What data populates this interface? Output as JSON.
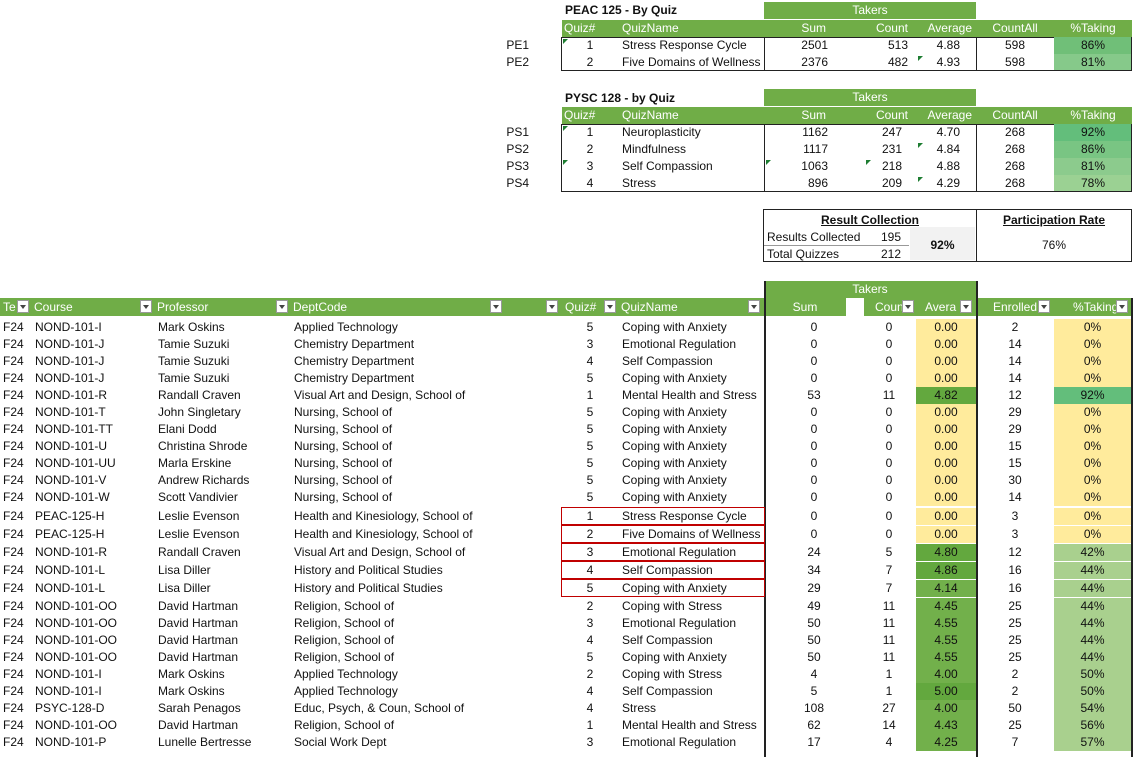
{
  "peac": {
    "title": "PEAC 125 - By Quiz",
    "takers_label": "Takers",
    "headers": [
      "Quiz#",
      "QuizName",
      "Sum",
      "Count",
      "Average",
      "CountAll",
      "%Taking"
    ],
    "rows": [
      {
        "id": "PE1",
        "quiz": "1",
        "name": "Stress Response Cycle",
        "sum": "2501",
        "count": "513",
        "avg": "4.88",
        "countall": "598",
        "pct": "86%"
      },
      {
        "id": "PE2",
        "quiz": "2",
        "name": "Five Domains of Wellness",
        "sum": "2376",
        "count": "482",
        "avg": "4.93",
        "countall": "598",
        "pct": "81%"
      }
    ]
  },
  "pysc": {
    "title": "PYSC 128 - by Quiz",
    "takers_label": "Takers",
    "headers": [
      "Quiz#",
      "QuizName",
      "Sum",
      "Count",
      "Average",
      "CountAll",
      "%Taking"
    ],
    "rows": [
      {
        "id": "PS1",
        "quiz": "1",
        "name": "Neuroplasticity",
        "sum": "1162",
        "count": "247",
        "avg": "4.70",
        "countall": "268",
        "pct": "92%"
      },
      {
        "id": "PS2",
        "quiz": "2",
        "name": "Mindfulness",
        "sum": "1117",
        "count": "231",
        "avg": "4.84",
        "countall": "268",
        "pct": "86%"
      },
      {
        "id": "PS3",
        "quiz": "3",
        "name": "Self Compassion",
        "sum": "1063",
        "count": "218",
        "avg": "4.88",
        "countall": "268",
        "pct": "81%"
      },
      {
        "id": "PS4",
        "quiz": "4",
        "name": "Stress",
        "sum": "896",
        "count": "209",
        "avg": "4.29",
        "countall": "268",
        "pct": "78%"
      }
    ]
  },
  "result_collection": {
    "title": "Result Collection",
    "collected_label": "Results Collected",
    "collected_value": "195",
    "total_label": "Total Quizzes",
    "total_value": "212",
    "pct": "92%"
  },
  "participation": {
    "title": "Participation Rate",
    "value": "76%"
  },
  "main": {
    "takers_label": "Takers",
    "headers": [
      "Te",
      "Course",
      "Professor",
      "DeptCode",
      "Quiz#",
      "QuizName",
      "Sum",
      "Coun",
      "Avera",
      "Enrolled",
      "%Taking"
    ],
    "rows": [
      [
        "F24",
        "NOND-101-I",
        "Mark Oskins",
        "Applied Technology",
        "5",
        "Coping with Anxiety",
        "0",
        "0",
        "0.00",
        "2",
        "0%"
      ],
      [
        "F24",
        "NOND-101-J",
        "Tamie Suzuki",
        "Chemistry Department",
        "3",
        "Emotional Regulation",
        "0",
        "0",
        "0.00",
        "14",
        "0%"
      ],
      [
        "F24",
        "NOND-101-J",
        "Tamie Suzuki",
        "Chemistry Department",
        "4",
        "Self Compassion",
        "0",
        "0",
        "0.00",
        "14",
        "0%"
      ],
      [
        "F24",
        "NOND-101-J",
        "Tamie Suzuki",
        "Chemistry Department",
        "5",
        "Coping with Anxiety",
        "0",
        "0",
        "0.00",
        "14",
        "0%"
      ],
      [
        "F24",
        "NOND-101-R",
        "Randall Craven",
        "Visual Art and Design, School of",
        "1",
        "Mental Health and Stress",
        "53",
        "11",
        "4.82",
        "12",
        "92%"
      ],
      [
        "F24",
        "NOND-101-T",
        "John Singletary",
        "Nursing, School of",
        "5",
        "Coping with Anxiety",
        "0",
        "0",
        "0.00",
        "29",
        "0%"
      ],
      [
        "F24",
        "NOND-101-TT",
        "Elani Dodd",
        "Nursing, School of",
        "5",
        "Coping with Anxiety",
        "0",
        "0",
        "0.00",
        "29",
        "0%"
      ],
      [
        "F24",
        "NOND-101-U",
        "Christina Shrode",
        "Nursing, School of",
        "5",
        "Coping with Anxiety",
        "0",
        "0",
        "0.00",
        "15",
        "0%"
      ],
      [
        "F24",
        "NOND-101-UU",
        "Marla Erskine",
        "Nursing, School of",
        "5",
        "Coping with Anxiety",
        "0",
        "0",
        "0.00",
        "15",
        "0%"
      ],
      [
        "F24",
        "NOND-101-V",
        "Andrew Richards",
        "Nursing, School of",
        "5",
        "Coping with Anxiety",
        "0",
        "0",
        "0.00",
        "30",
        "0%"
      ],
      [
        "F24",
        "NOND-101-W",
        "Scott Vandivier",
        "Nursing, School of",
        "5",
        "Coping with Anxiety",
        "0",
        "0",
        "0.00",
        "14",
        "0%"
      ],
      [
        "F24",
        "PEAC-125-H",
        "Leslie Evenson",
        "Health and Kinesiology, School of",
        "1",
        "Stress Response Cycle",
        "0",
        "0",
        "0.00",
        "3",
        "0%"
      ],
      [
        "F24",
        "PEAC-125-H",
        "Leslie Evenson",
        "Health and Kinesiology, School of",
        "2",
        "Five Domains of Wellness",
        "0",
        "0",
        "0.00",
        "3",
        "0%"
      ],
      [
        "F24",
        "NOND-101-R",
        "Randall Craven",
        "Visual Art and Design, School of",
        "3",
        "Emotional Regulation",
        "24",
        "5",
        "4.80",
        "12",
        "42%"
      ],
      [
        "F24",
        "NOND-101-L",
        "Lisa Diller",
        "History and Political Studies",
        "4",
        "Self Compassion",
        "34",
        "7",
        "4.86",
        "16",
        "44%"
      ],
      [
        "F24",
        "NOND-101-L",
        "Lisa Diller",
        "History and Political Studies",
        "5",
        "Coping with Anxiety",
        "29",
        "7",
        "4.14",
        "16",
        "44%"
      ],
      [
        "F24",
        "NOND-101-OO",
        "David Hartman",
        "Religion, School of",
        "2",
        "Coping with Stress",
        "49",
        "11",
        "4.45",
        "25",
        "44%"
      ],
      [
        "F24",
        "NOND-101-OO",
        "David Hartman",
        "Religion, School of",
        "3",
        "Emotional Regulation",
        "50",
        "11",
        "4.55",
        "25",
        "44%"
      ],
      [
        "F24",
        "NOND-101-OO",
        "David Hartman",
        "Religion, School of",
        "4",
        "Self Compassion",
        "50",
        "11",
        "4.55",
        "25",
        "44%"
      ],
      [
        "F24",
        "NOND-101-OO",
        "David Hartman",
        "Religion, School of",
        "5",
        "Coping with Anxiety",
        "50",
        "11",
        "4.55",
        "25",
        "44%"
      ],
      [
        "F24",
        "NOND-101-I",
        "Mark Oskins",
        "Applied Technology",
        "2",
        "Coping with Stress",
        "4",
        "1",
        "4.00",
        "2",
        "50%"
      ],
      [
        "F24",
        "NOND-101-I",
        "Mark Oskins",
        "Applied Technology",
        "4",
        "Self Compassion",
        "5",
        "1",
        "5.00",
        "2",
        "50%"
      ],
      [
        "F24",
        "PSYC-128-D",
        "Sarah Penagos",
        "Educ, Psych, & Coun, School of",
        "4",
        "Stress",
        "108",
        "27",
        "4.00",
        "50",
        "54%"
      ],
      [
        "F24",
        "NOND-101-OO",
        "David Hartman",
        "Religion, School of",
        "1",
        "Mental Health and Stress",
        "62",
        "14",
        "4.43",
        "25",
        "56%"
      ],
      [
        "F24",
        "NOND-101-P",
        "Lunelle Bertresse",
        "Social Work Dept",
        "3",
        "Emotional Regulation",
        "17",
        "4",
        "4.25",
        "7",
        "57%"
      ]
    ]
  }
}
